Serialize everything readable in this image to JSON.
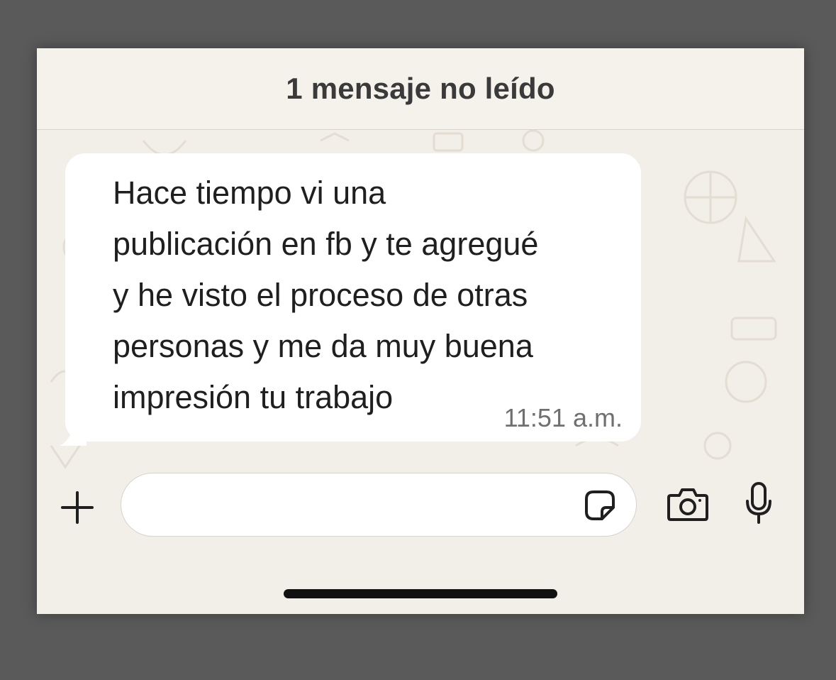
{
  "unread_banner": {
    "text": "1 mensaje no leído"
  },
  "message": {
    "text": "Hace tiempo vi una\npublicación en fb y te agregué\ny he visto el proceso de otras\npersonas y me da muy buena\nimpresión tu trabajo",
    "time": "11:51 a.m.",
    "direction": "incoming"
  },
  "composer": {
    "input_value": "",
    "icons": {
      "attach": "plus-icon",
      "sticker": "sticker-icon",
      "camera": "camera-icon",
      "mic": "microphone-icon"
    }
  },
  "colors": {
    "chat_background": "#f2efe9",
    "bubble": "#ffffff",
    "timestamp": "#6f6f6f"
  }
}
